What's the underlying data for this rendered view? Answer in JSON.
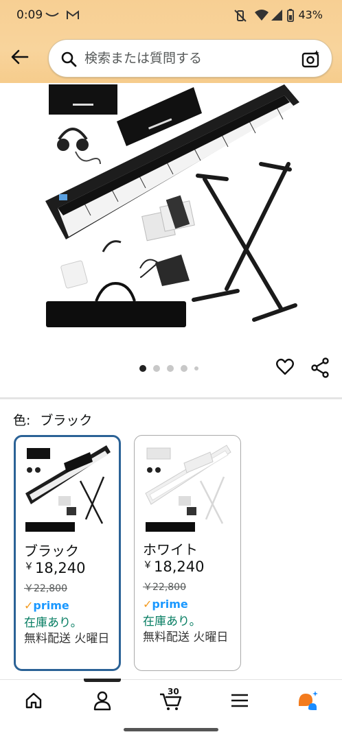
{
  "status_bar": {
    "time": "0:09",
    "battery": "43%",
    "icons": [
      "missed-call-icon",
      "gmail-icon",
      "vibrate-off-icon",
      "wifi-icon",
      "signal-icon",
      "battery-icon"
    ]
  },
  "search": {
    "placeholder": "検索または質問する",
    "icons": [
      "back-arrow-icon",
      "search-icon",
      "camera-sparkle-icon"
    ]
  },
  "gallery": {
    "image_count": 5,
    "active_index": 0,
    "actions": [
      "heart-icon",
      "share-icon"
    ]
  },
  "variation": {
    "label": "色:",
    "selected": "ブラック"
  },
  "options": [
    {
      "name": "ブラック",
      "currency": "￥",
      "price": "18,240",
      "was": "￥22,800",
      "prime": "prime",
      "stock": "在庫あり。",
      "shipping": "無料配送 火曜日",
      "selected": true,
      "theme": "#1a1a1a"
    },
    {
      "name": "ホワイト",
      "currency": "￥",
      "price": "18,240",
      "was": "￥22,800",
      "prime": "prime",
      "stock": "在庫あり。",
      "shipping": "無料配送 火曜日",
      "selected": false,
      "theme": "#f2f2f2"
    }
  ],
  "bottom_nav": {
    "cart_count": "30",
    "items": [
      "home-icon",
      "account-icon",
      "cart-icon",
      "menu-icon",
      "rufus-icon"
    ]
  },
  "colors": {
    "header": "#f8d49c",
    "selected_border": "#2b6296",
    "in_stock": "#067d62",
    "prime": "#1a98ff"
  }
}
